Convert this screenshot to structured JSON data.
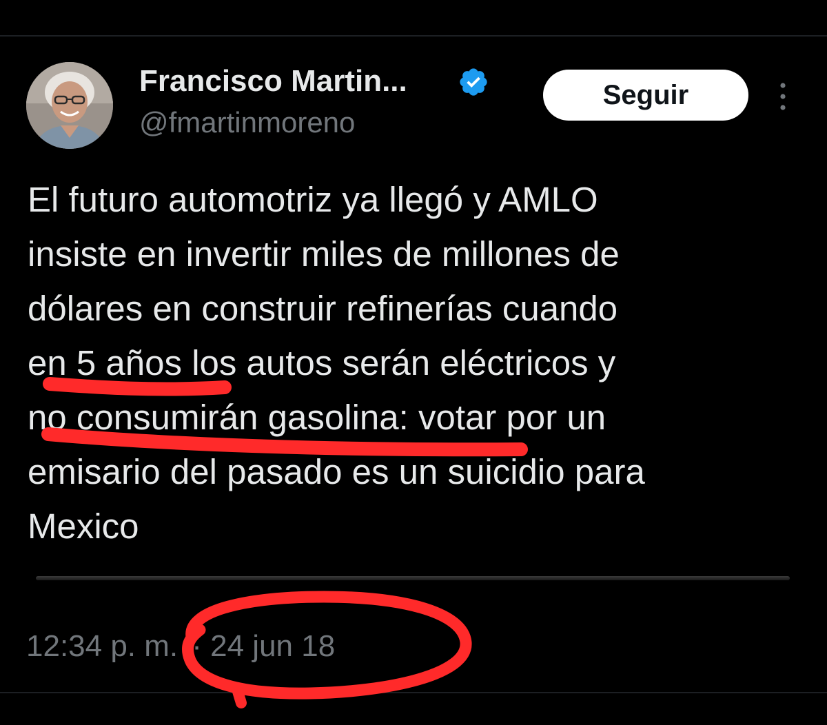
{
  "author": {
    "display_name": "Francisco Martin...",
    "handle": "@fmartinmoreno",
    "verified": true,
    "avatar_icon": "profile-photo"
  },
  "actions": {
    "follow_label": "Seguir",
    "more_icon": "more-vertical-icon"
  },
  "tweet": {
    "lines": [
      "El futuro automotriz ya llegó y AMLO",
      "insiste en invertir miles de millones de",
      "dólares en construir refinerías cuando",
      "en 5 años los autos serán eléctricos y",
      "no consumirán gasolina: votar por un",
      "emisario del pasado es un suicidio para",
      "Mexico"
    ]
  },
  "meta": {
    "time": "12:34 p. m.",
    "separator": "·",
    "date": "24 jun 18"
  },
  "colors": {
    "background": "#000000",
    "text_primary": "#e7e9ea",
    "text_secondary": "#71767b",
    "verified_blue": "#1d9bf0",
    "annotation_red": "#ff2a2a"
  }
}
